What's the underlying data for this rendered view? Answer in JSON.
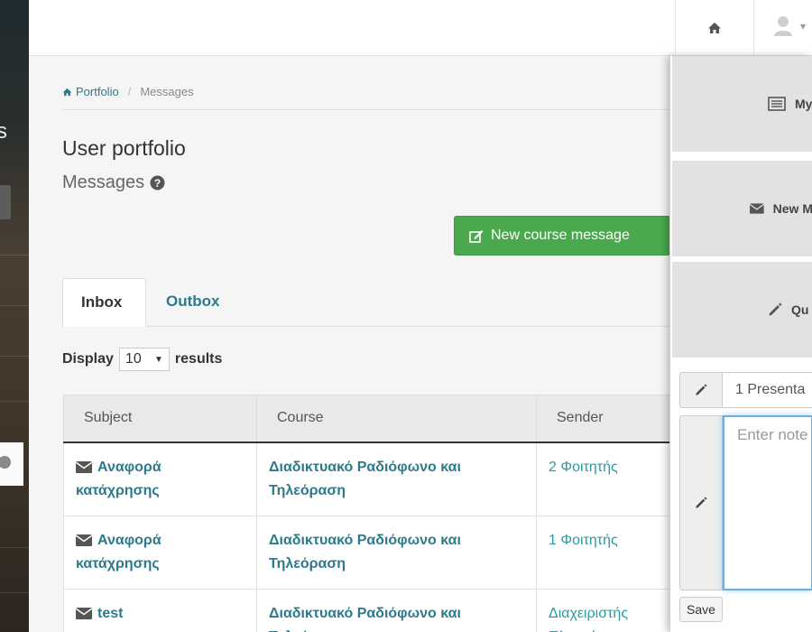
{
  "breadcrumb": {
    "home": "Portfolio",
    "separator": "/",
    "current": "Messages"
  },
  "page": {
    "title": "User portfolio",
    "subtitle": "Messages"
  },
  "actions": {
    "new_course_message": "New course message"
  },
  "tabs": [
    {
      "label": "Inbox",
      "active": true
    },
    {
      "label": "Outbox",
      "active": false
    }
  ],
  "display": {
    "prefix": "Display",
    "value": "10",
    "suffix": "results"
  },
  "table": {
    "headers": [
      "Subject",
      "Course",
      "Sender"
    ],
    "rows": [
      {
        "subject": "Αναφορά κατάχρησης",
        "course": "Διαδικτυακό Ραδιόφωνο και Τηλεόραση",
        "sender": "2 Φοιτητής"
      },
      {
        "subject": "Αναφορά κατάχρησης",
        "course": "Διαδικτυακό Ραδιόφωνο και Τηλεόραση",
        "sender": "1 Φοιτητής"
      },
      {
        "subject": "test",
        "course": "Διαδικτυακό Ραδιόφωνο και Τηλεόραση",
        "sender": "Διαχειριστής Πλατφόρμας"
      }
    ]
  },
  "notes_panel": {
    "tile_labels": [
      "My",
      "New M",
      "Qu"
    ],
    "title_value": "1 Presenta",
    "note_placeholder": "Enter note",
    "save_label": "Save"
  },
  "sidebar_fragment": "s",
  "colors": {
    "link": "#2c7a8a",
    "success": "#4aa84d",
    "focus": "#66afe9"
  }
}
